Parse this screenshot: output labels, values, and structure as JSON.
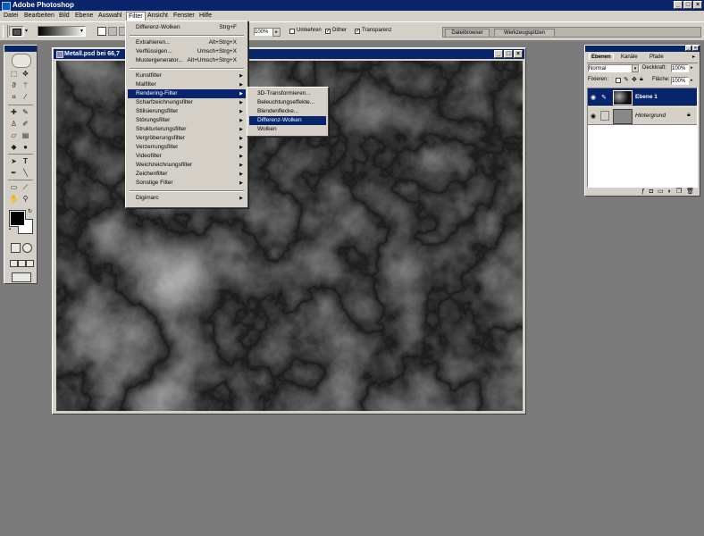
{
  "app": {
    "title": "Adobe Photoshop"
  },
  "menubar": [
    "Datei",
    "Bearbeiten",
    "Bild",
    "Ebene",
    "Auswahl",
    "Filter",
    "Ansicht",
    "Fenster",
    "Hilfe"
  ],
  "options": {
    "opacity_value": "100%",
    "reverse_label": "Umkehren",
    "dither_label": "Dither",
    "transparency_label": "Transparenz",
    "tabs": [
      "Dateibrowser",
      "Werkzeugspitzen"
    ]
  },
  "document": {
    "title": "Metall.psd bei 66,7"
  },
  "filter_menu": {
    "top": [
      {
        "label": "Differenz-Wolken",
        "shortcut": "Strg+F"
      }
    ],
    "group2": [
      {
        "label": "Extrahieren...",
        "shortcut": "Alt+Strg+X"
      },
      {
        "label": "Verflüssigen...",
        "shortcut": "Umsch+Strg+X"
      },
      {
        "label": "Mustergenerator...",
        "shortcut": "Alt+Umsch+Strg+X"
      }
    ],
    "group3": [
      "Kunstfilter",
      "Malfilter",
      "Rendering-Filter",
      "Scharfzeichnungsfilter",
      "Stilisierungsfilter",
      "Störungsfilter",
      "Strukturierungsfilter",
      "Vergröberungsfilter",
      "Verzerrungsfilter",
      "Videofilter",
      "Weichzeichnungsfilter",
      "Zeichenfilter",
      "Sonstige Filter"
    ],
    "group4": [
      "Digimarc"
    ]
  },
  "rendering_submenu": [
    "3D-Transformieren...",
    "Beleuchtungseffekte...",
    "Blendenflecke...",
    "Differenz-Wolken",
    "Wolken"
  ],
  "layers_panel": {
    "tabs": [
      "Ebenen",
      "Kanäle",
      "Pfade"
    ],
    "blend_mode": "Normal",
    "opacity_label": "Deckkraft:",
    "opacity_value": "100%",
    "lock_label": "Fixieren:",
    "fill_label": "Fläche:",
    "fill_value": "100%",
    "layers": [
      {
        "name": "Ebene 1",
        "selected": true
      },
      {
        "name": "Hintergrund",
        "selected": false
      }
    ]
  },
  "colors": {
    "accent": "#08246b",
    "chrome": "#d4d0c8",
    "workspace": "#7b7b7b"
  }
}
